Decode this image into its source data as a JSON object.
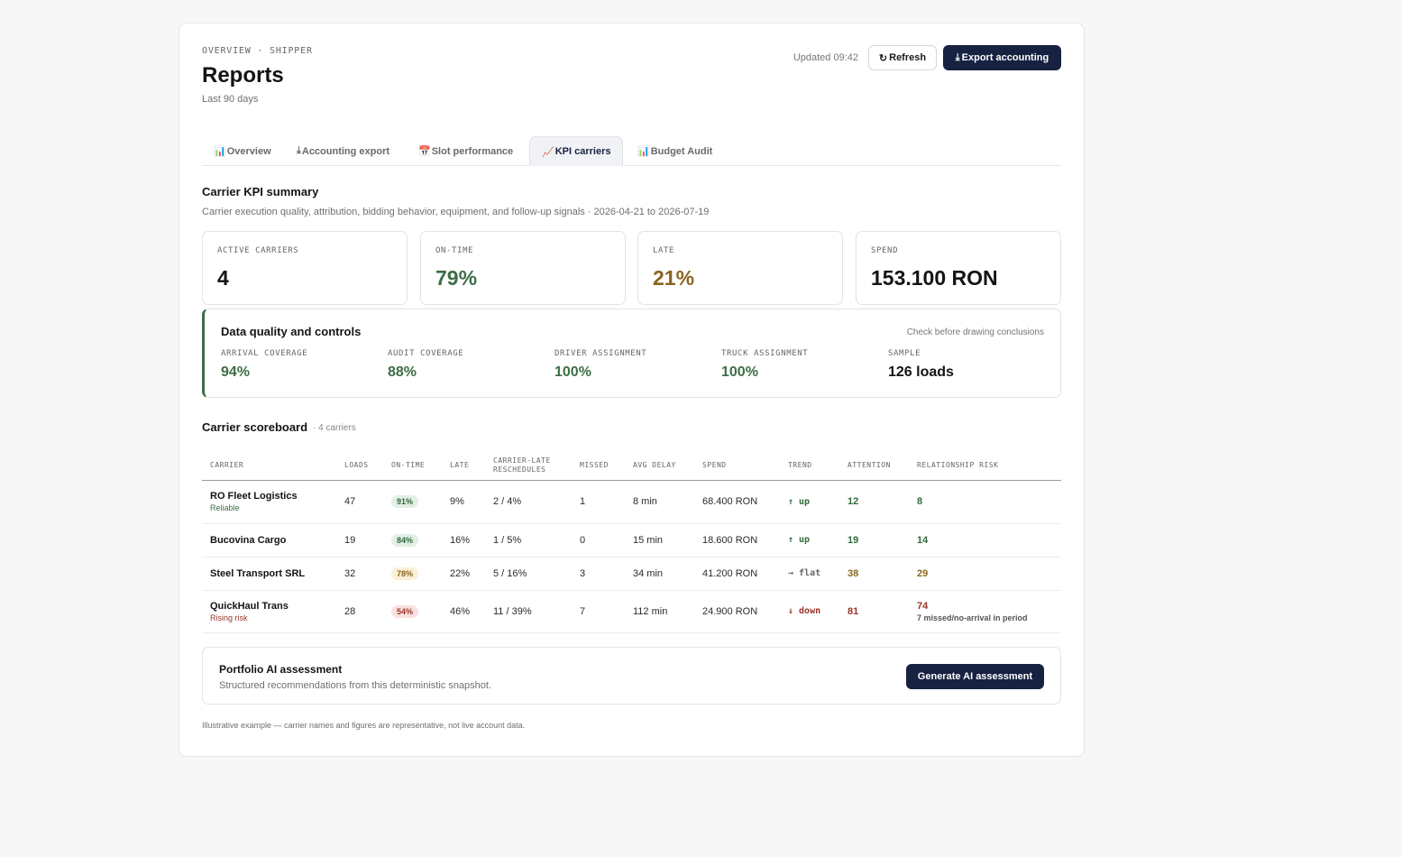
{
  "header": {
    "eyebrow": "OVERVIEW · SHIPPER",
    "title": "Reports",
    "range": "Last 90 days",
    "updated": "Updated 09:42",
    "refresh_icon": "↻",
    "refresh_label": "Refresh",
    "export_icon": "⤓",
    "export_label": "Export accounting"
  },
  "tabs": [
    {
      "icon": "📊",
      "label": "Overview",
      "icon_name": "bar-chart-icon"
    },
    {
      "icon": "⤓",
      "label": "Accounting export",
      "icon_name": "download-icon"
    },
    {
      "icon": "📅",
      "label": "Slot performance",
      "icon_name": "calendar-icon"
    },
    {
      "icon": "📈",
      "label": "KPI carriers",
      "icon_name": "trend-chart-icon",
      "active": true
    },
    {
      "icon": "📊",
      "label": "Budget Audit",
      "icon_name": "bar-chart-icon"
    }
  ],
  "summary": {
    "title": "Carrier KPI summary",
    "description": "Carrier execution quality, attribution, bidding behavior, equipment, and follow-up signals · 2026-04-21 to 2026-07-19"
  },
  "kpis": [
    {
      "label": "ACTIVE CARRIERS",
      "value": "4",
      "color": "#141414"
    },
    {
      "label": "ON-TIME",
      "value": "79%",
      "color": "#3c6e46"
    },
    {
      "label": "LATE",
      "value": "21%",
      "color": "#8a6420"
    },
    {
      "label": "SPEND",
      "value": "153.100 RON",
      "color": "#141414"
    }
  ],
  "data_quality": {
    "title": "Data quality and controls",
    "note": "Check before drawing conclusions",
    "accent": "#3c6e46",
    "metrics": [
      {
        "label": "ARRIVAL COVERAGE",
        "value": "94%",
        "color": "#3c6e46"
      },
      {
        "label": "AUDIT COVERAGE",
        "value": "88%",
        "color": "#3c6e46"
      },
      {
        "label": "DRIVER ASSIGNMENT",
        "value": "100%",
        "color": "#3c6e46"
      },
      {
        "label": "TRUCK ASSIGNMENT",
        "value": "100%",
        "color": "#3c6e46"
      },
      {
        "label": "SAMPLE",
        "value": "126 loads",
        "color": "#141414"
      }
    ]
  },
  "scoreboard": {
    "title": "Carrier scoreboard",
    "count": "· 4 carriers",
    "columns": [
      "CARRIER",
      "LOADS",
      "ON-TIME",
      "LATE",
      "CARRIER-LATE RESCHEDULES",
      "MISSED",
      "AVG DELAY",
      "SPEND",
      "TREND",
      "ATTENTION",
      "RELATIONSHIP RISK"
    ],
    "rows": [
      {
        "carrier": "RO Fleet Logistics",
        "tag": "Reliable",
        "tag_color": "#3c6e46",
        "loads": "47",
        "on_time": "91%",
        "pill_bg": "#e3efe4",
        "pill_fg": "#2f6a3a",
        "late": "9%",
        "reschedules": "2 / 4%",
        "missed": "1",
        "avg_delay": "8 min",
        "spend": "68.400 RON",
        "trend": "↑ up",
        "trend_color": "#2f6a3a",
        "attention": "12",
        "attention_color": "#2f6a3a",
        "risk": "8",
        "risk_color": "#2f6a3a",
        "risk_note": ""
      },
      {
        "carrier": "Bucovina Cargo",
        "tag": "",
        "tag_color": "#3c6e46",
        "loads": "19",
        "on_time": "84%",
        "pill_bg": "#e3efe4",
        "pill_fg": "#2f6a3a",
        "late": "16%",
        "reschedules": "1 / 5%",
        "missed": "0",
        "avg_delay": "15 min",
        "spend": "18.600 RON",
        "trend": "↑ up",
        "trend_color": "#2f6a3a",
        "attention": "19",
        "attention_color": "#2f6a3a",
        "risk": "14",
        "risk_color": "#2f6a3a",
        "risk_note": ""
      },
      {
        "carrier": "Steel Transport SRL",
        "tag": "",
        "tag_color": "#3c6e46",
        "loads": "32",
        "on_time": "78%",
        "pill_bg": "#fbefd6",
        "pill_fg": "#8a6420",
        "late": "22%",
        "reschedules": "5 / 16%",
        "missed": "3",
        "avg_delay": "34 min",
        "spend": "41.200 RON",
        "trend": "→ flat",
        "trend_color": "#666666",
        "attention": "38",
        "attention_color": "#8a6420",
        "risk": "29",
        "risk_color": "#8a6420",
        "risk_note": ""
      },
      {
        "carrier": "QuickHaul Trans",
        "tag": "Rising risk",
        "tag_color": "#9a3428",
        "loads": "28",
        "on_time": "54%",
        "pill_bg": "#f8e1de",
        "pill_fg": "#9a3428",
        "late": "46%",
        "reschedules": "11 / 39%",
        "missed": "7",
        "avg_delay": "112 min",
        "spend": "24.900 RON",
        "trend": "↓ down",
        "trend_color": "#9a3428",
        "attention": "81",
        "attention_color": "#9a3428",
        "risk": "74",
        "risk_color": "#9a3428",
        "risk_note": "7 missed/no-arrival in period"
      }
    ]
  },
  "ai": {
    "title": "Portfolio AI assessment",
    "description": "Structured recommendations from this deterministic snapshot.",
    "button": "Generate AI assessment"
  },
  "footnote": "Illustrative example — carrier names and figures are representative, not live account data."
}
